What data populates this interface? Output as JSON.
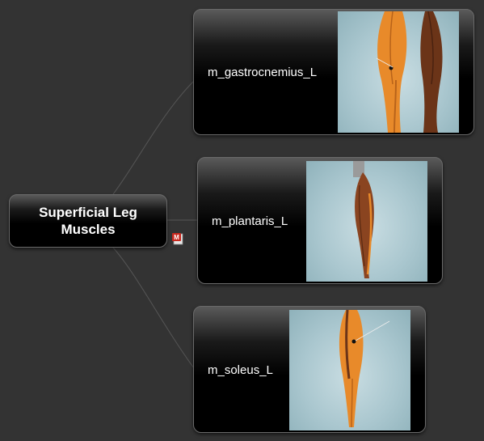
{
  "root": {
    "title": "Superficial Leg Muscles"
  },
  "children": [
    {
      "label": "m_gastrocnemius_L",
      "image_icon": "leg-muscle-gastrocnemius-image"
    },
    {
      "label": "m_plantaris_L",
      "image_icon": "leg-muscle-plantaris-image"
    },
    {
      "label": "m_soleus_L",
      "image_icon": "leg-muscle-soleus-image"
    }
  ],
  "attachment": {
    "icon": "mindmap-attachment-icon"
  },
  "colors": {
    "background": "#333333",
    "connector": "#555555",
    "muscle_highlight": "#e88a2a",
    "muscle_dark": "#6b3418"
  }
}
